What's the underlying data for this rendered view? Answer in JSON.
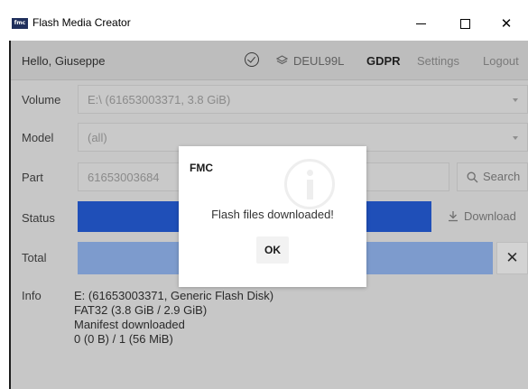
{
  "window": {
    "title": "Flash Media Creator",
    "icon_text": "fmc",
    "minimize_icon": "minimize-icon",
    "maximize_icon": "maximize-icon",
    "close_glyph": "✕"
  },
  "header": {
    "greeting": "Hello, Giuseppe",
    "verified_icon": "check-circle-icon",
    "dealer_icon": "layers-icon",
    "dealer_code": "DEUL99L",
    "gdpr": "GDPR",
    "settings": "Settings",
    "logout": "Logout"
  },
  "form": {
    "volume": {
      "label": "Volume",
      "value": "E:\\ (61653003371, 3.8 GiB)"
    },
    "model": {
      "label": "Model",
      "value": "(all)"
    },
    "part": {
      "label": "Part",
      "value": "61653003684",
      "search_label": "Search"
    },
    "status": {
      "label": "Status",
      "download_label": "Download"
    },
    "total": {
      "label": "Total",
      "close_glyph": "✕"
    },
    "info": {
      "label": "Info",
      "lines": [
        "E: (61653003371, Generic Flash Disk)",
        "FAT32 (3.8 GiB / 2.9 GiB)",
        "Manifest downloaded",
        "0 (0 B) / 1 (56 MiB)"
      ]
    }
  },
  "dialog": {
    "title": "FMC",
    "message": "Flash files downloaded!",
    "ok_label": "OK",
    "watermark_icon": "info-icon"
  },
  "colors": {
    "status_bar": "#1f4fb8",
    "total_bar": "#7d9bcd",
    "overlay": "#c7c7c7"
  }
}
